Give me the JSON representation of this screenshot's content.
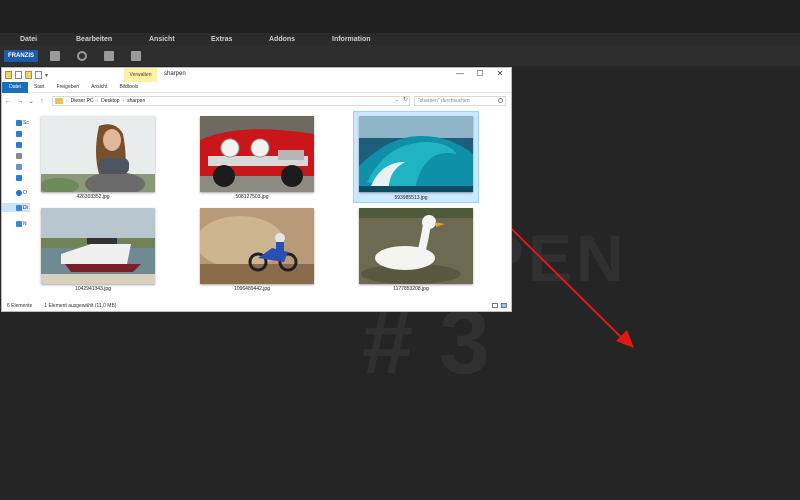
{
  "host": {
    "menu": [
      "Datei",
      "Bearbeiten",
      "Ansicht",
      "Extras",
      "Addons",
      "Information"
    ],
    "brand": "FRANZIS",
    "toolbar_icons": [
      "batch-icon",
      "target-icon",
      "export-icon",
      "film-icon"
    ],
    "watermark_line1": "PEN",
    "watermark_line2": "# 3"
  },
  "explorer": {
    "window_title": "sharpen",
    "context_tab": "Verwalten",
    "window_buttons": {
      "minimize": "—",
      "maximize": "☐",
      "close": "✕"
    },
    "ribbon_tabs": [
      "Datei",
      "Start",
      "Freigeben",
      "Ansicht",
      "Bildtools"
    ],
    "nav_buttons": {
      "back": "←",
      "forward": "→",
      "recent": "⌄",
      "up": "↑"
    },
    "breadcrumb": [
      "Dieser PC",
      "Desktop",
      "sharpen"
    ],
    "breadcrumb_sep": "›",
    "address_dropdown": "⌄",
    "address_refresh": "↻",
    "search_placeholder": "\"sharpen\" durchsuchen",
    "nav_pane": [
      {
        "label": "Sc",
        "icon": "star-icon",
        "color": "#2b7cd3"
      },
      {
        "label": "",
        "icon": "desktop-icon",
        "color": "#2b7cd3"
      },
      {
        "label": "",
        "icon": "download-icon",
        "color": "#2b7cd3"
      },
      {
        "label": "",
        "icon": "document-icon",
        "color": "#8a8a8a"
      },
      {
        "label": "",
        "icon": "picture-icon",
        "color": "#6a93c9"
      },
      {
        "label": "",
        "icon": "music-icon",
        "color": "#2b7cd3"
      },
      {
        "label": "O",
        "icon": "cloud-icon",
        "color": "#1e73d8"
      },
      {
        "label": "Di",
        "icon": "computer-icon",
        "color": "#3a89d9"
      },
      {
        "label": "N",
        "icon": "network-icon",
        "color": "#3a89d9"
      }
    ],
    "files": [
      {
        "name": "426303352.jpg",
        "subject": "woman-portrait",
        "selected": false
      },
      {
        "name": "508127503.jpg",
        "subject": "red-vintage-car",
        "selected": false
      },
      {
        "name": "593985513.jpg",
        "subject": "ocean-wave",
        "selected": true
      },
      {
        "name": "1042941343.jpg",
        "subject": "motorboat",
        "selected": false
      },
      {
        "name": "1096489442.jpg",
        "subject": "motocross-rider",
        "selected": false
      },
      {
        "name": "1177853208.jpg",
        "subject": "white-duck",
        "selected": false
      }
    ],
    "status": {
      "count": "6 Elemente",
      "selection": "1 Element ausgewählt (11,0 MB)"
    }
  },
  "colors": {
    "app_background": "#252525",
    "arrow": "#e01818",
    "selection_fill": "#cce8ff",
    "file_tab": "#1a6fbd"
  }
}
